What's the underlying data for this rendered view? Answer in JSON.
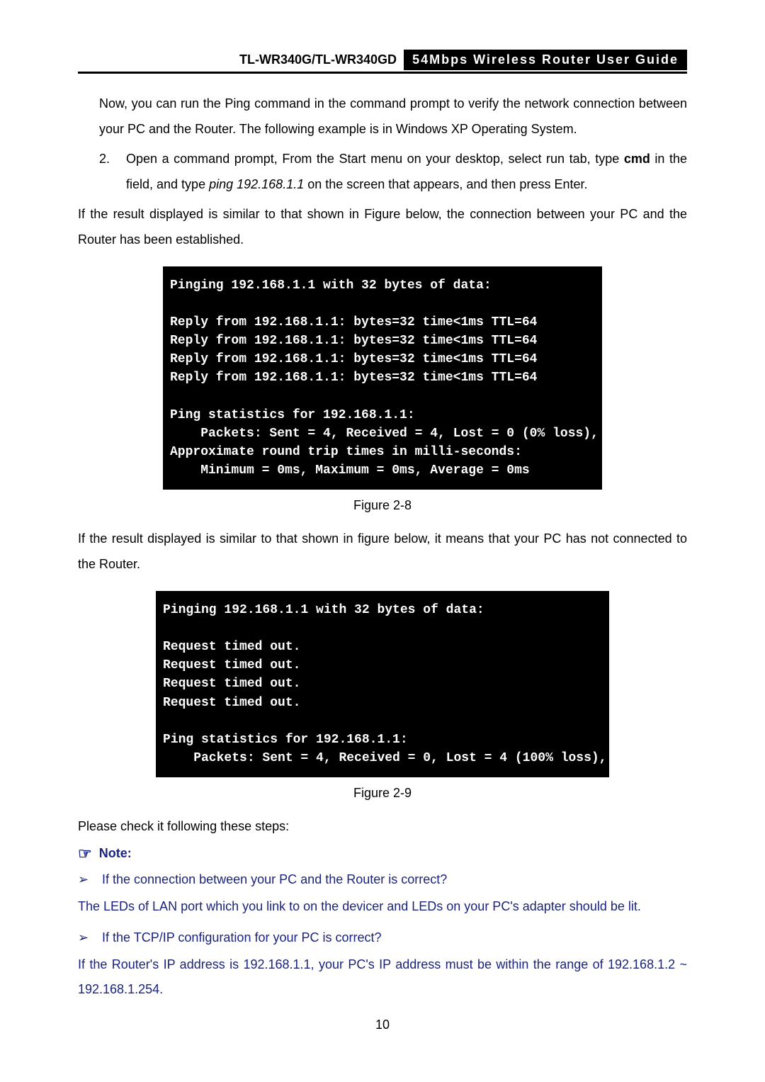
{
  "header": {
    "left": "TL-WR340G/TL-WR340GD",
    "right": "54Mbps Wireless Router User Guide"
  },
  "para1": "Now, you can run the Ping command in the command prompt to verify the network connection between your PC and the Router. The following example is in Windows XP Operating System.",
  "step2": {
    "num": "2.",
    "pre": "Open a command prompt, From the Start menu on your desktop, select run tab, type ",
    "cmd_bold": "cmd",
    "mid": " in the field, and type ",
    "cmd_italic": "ping 192.168.1.1",
    "post": " on the screen that appears, and then press Enter."
  },
  "para2": "If the result displayed is similar to that shown in Figure below, the connection between your PC and the Router has been established.",
  "terminal1": "Pinging 192.168.1.1 with 32 bytes of data:\n\nReply from 192.168.1.1: bytes=32 time<1ms TTL=64\nReply from 192.168.1.1: bytes=32 time<1ms TTL=64\nReply from 192.168.1.1: bytes=32 time<1ms TTL=64\nReply from 192.168.1.1: bytes=32 time<1ms TTL=64\n\nPing statistics for 192.168.1.1:\n    Packets: Sent = 4, Received = 4, Lost = 0 (0% loss),\nApproximate round trip times in milli-seconds:\n    Minimum = 0ms, Maximum = 0ms, Average = 0ms",
  "figcap1": "Figure 2-8",
  "para3": "If the result displayed is similar to that shown in figure below, it means that your PC has not connected to the Router.",
  "terminal2": "Pinging 192.168.1.1 with 32 bytes of data:\n\nRequest timed out.\nRequest timed out.\nRequest timed out.\nRequest timed out.\n\nPing statistics for 192.168.1.1:\n    Packets: Sent = 4, Received = 0, Lost = 4 (100% loss),",
  "figcap2": "Figure 2-9",
  "para4": "Please check it following these steps:",
  "note": {
    "hand": "☞",
    "label": "Note:"
  },
  "bullets": {
    "mark": "➢",
    "b1": "If the connection between your PC and the Router is correct?",
    "p1": "The LEDs of LAN port which you link to on the devicer and LEDs on your PC's adapter should be lit.",
    "b2": "If the TCP/IP configuration for your PC is correct?",
    "p2": "If the Router's IP address is 192.168.1.1, your PC's IP address must be within the range of 192.168.1.2 ~ 192.168.1.254."
  },
  "page_number": "10"
}
